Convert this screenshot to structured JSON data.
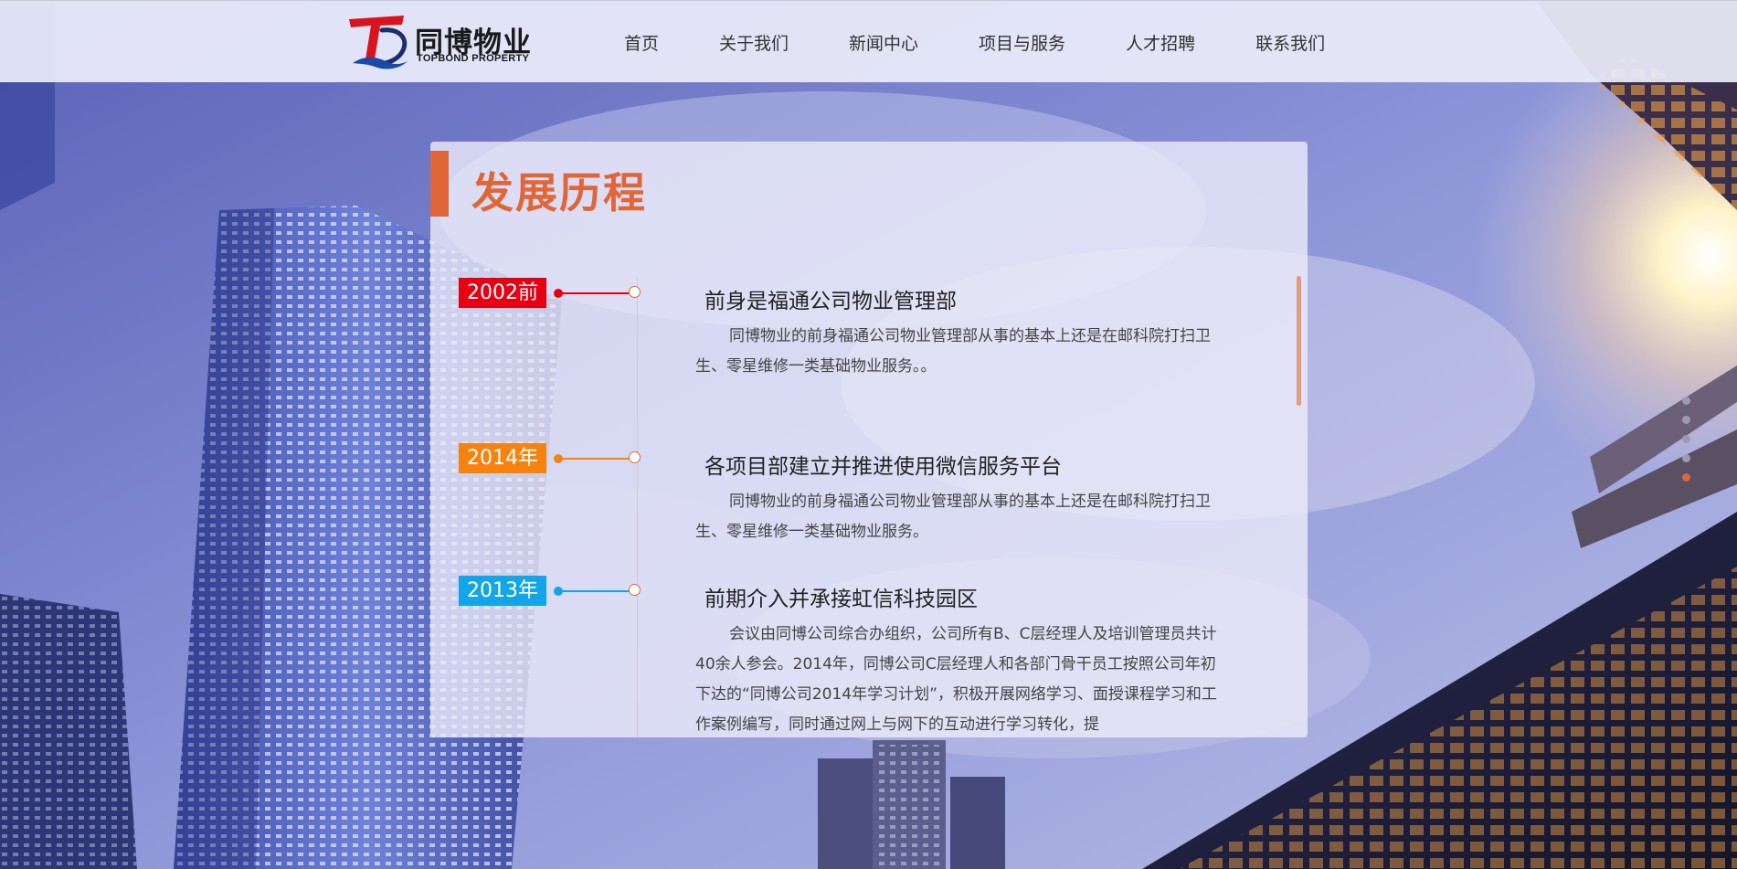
{
  "brand": {
    "name_cn": "同博物业",
    "name_en": "TOPBOND PROPERTY"
  },
  "nav": {
    "items": [
      "首页",
      "关于我们",
      "新闻中心",
      "项目与服务",
      "人才招聘",
      "联系我们"
    ]
  },
  "section": {
    "title": "发展历程"
  },
  "timeline": [
    {
      "year": "2002前",
      "color": "#e60012",
      "heading": "前身是福通公司物业管理部",
      "body": "同博物业的前身福通公司物业管理部从事的基本上还是在邮科院打扫卫生、零星维修一类基础物业服务。。"
    },
    {
      "year": "2014年",
      "color": "#f7830f",
      "heading": "各项目部建立并推进使用微信服务平台",
      "body": "同博物业的前身福通公司物业管理部从事的基本上还是在邮科院打扫卫生、零星维修一类基础物业服务。"
    },
    {
      "year": "2013年",
      "color": "#12a5e8",
      "heading": "前期介入并承接虹信科技园区",
      "body": "会议由同博公司综合办组织，公司所有B、C层经理人及培训管理员共计40余人参会。2014年，同博公司C层经理人和各部门骨干员工按照公司年初下达的“同博公司2014年学习计划”，积极开展网络学习、面授课程学习和工作案例编写，同时通过网上与网下的互动进行学习转化，提"
    }
  ],
  "pagination": {
    "count": 5,
    "active_index": 4
  },
  "colors": {
    "accent": "#e06537"
  }
}
